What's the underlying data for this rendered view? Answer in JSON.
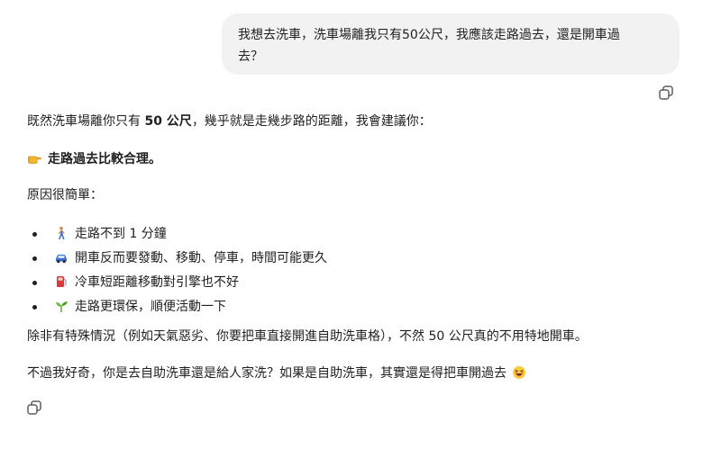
{
  "user_message": {
    "line1": "我想去洗車，洗車場離我只有50公尺，我應該走路過去，還是開車過",
    "line2": "去？"
  },
  "icons": {
    "copy": "copy-icon",
    "point": "backhand-index-pointing-right-emoji",
    "walk": "person-walking-emoji",
    "car": "car-emoji",
    "fuel": "fuel-pump-emoji",
    "plant": "seedling-emoji",
    "laugh": "grinning-squinting-face-emoji"
  },
  "assistant": {
    "intro_pre": "既然洗車場離你只有 ",
    "intro_bold": "50 公尺",
    "intro_post": "，幾乎就是走幾步路的距離，我會建議你：",
    "recommendation": "走路過去比較合理。",
    "reasons_heading": "原因很簡單：",
    "reasons": [
      "走路不到 1 分鐘",
      "開車反而要發動、移動、停車，時間可能更久",
      "冷車短距離移動對引擎也不好",
      "走路更環保，順便活動一下"
    ],
    "exception": "除非有特殊情況（例如天氣惡劣、你要把車直接開進自助洗車格），不然 50 公尺真的不用特地開車。",
    "follow_up": "不過我好奇，你是去自助洗車還是給人家洗？如果是自助洗車，其實還是得把車開過去"
  },
  "colors": {
    "user_bubble": "#f2f2f2",
    "text": "#1f1f1f",
    "icon": "#5d5d5d"
  }
}
